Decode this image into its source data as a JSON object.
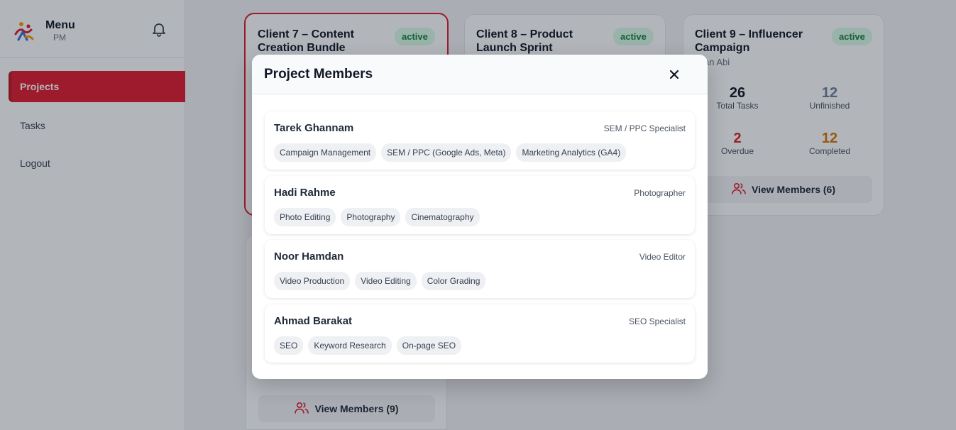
{
  "sidebar": {
    "title": "Menu",
    "subtitle": "PM",
    "nav": [
      {
        "label": "Projects"
      },
      {
        "label": "Tasks"
      },
      {
        "label": "Logout"
      }
    ]
  },
  "cards": [
    {
      "title": "Client 7 – Content Creation Bundle",
      "status": "active",
      "view_members": "View Members (9)"
    },
    {
      "title": "Client 8 – Product Launch Sprint",
      "status": "active"
    },
    {
      "title": "Client 9 – Influencer Campaign",
      "status": "active",
      "owner": "ssan Abi",
      "stats": {
        "total_tasks": {
          "value": "26",
          "label": "Total Tasks"
        },
        "unfinished": {
          "value": "12",
          "label": "Unfinished"
        },
        "overdue": {
          "value": "2",
          "label": "Overdue"
        },
        "completed": {
          "value": "12",
          "label": "Completed"
        }
      },
      "view_members": "View Members (6)"
    }
  ],
  "modal": {
    "title": "Project Members",
    "members": [
      {
        "name": "Tarek Ghannam",
        "role": "SEM / PPC Specialist",
        "skills": [
          "Campaign Management",
          "SEM / PPC (Google Ads, Meta)",
          "Marketing Analytics (GA4)"
        ]
      },
      {
        "name": "Hadi Rahme",
        "role": "Photographer",
        "skills": [
          "Photo Editing",
          "Photography",
          "Cinematography"
        ]
      },
      {
        "name": "Noor Hamdan",
        "role": "Video Editor",
        "skills": [
          "Video Production",
          "Video Editing",
          "Color Grading"
        ]
      },
      {
        "name": "Ahmad Barakat",
        "role": "SEO Specialist",
        "skills": [
          "SEO",
          "Keyword Research",
          "On-page SEO"
        ]
      }
    ]
  },
  "colors": {
    "accent": "#e11d2e",
    "badge_bg": "#dcfce7",
    "badge_text": "#15803d",
    "stat_dark": "#111827",
    "stat_gray": "#6b7fa3",
    "stat_red": "#dc2626",
    "stat_amber": "#d97706"
  },
  "icons": {
    "logo": "brand-logo-icon",
    "bell": "bell-icon",
    "close": "close-icon",
    "users": "users-icon"
  }
}
